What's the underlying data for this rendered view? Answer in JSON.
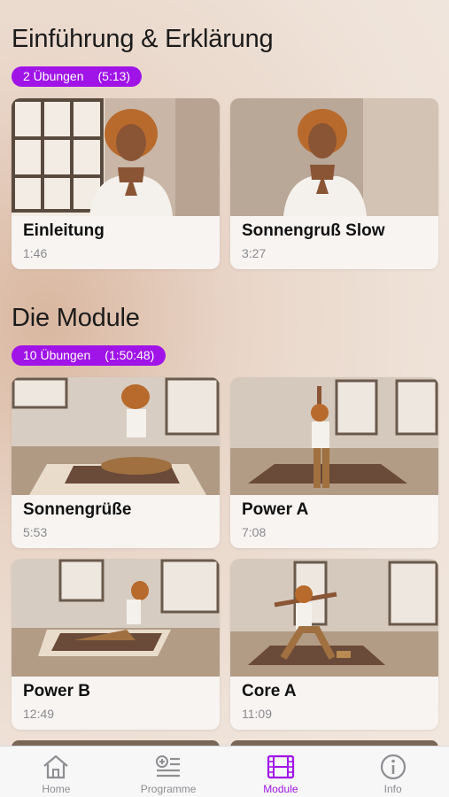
{
  "sections": [
    {
      "title": "Einführung & Erklärung",
      "pill": {
        "count": "2 Übungen",
        "duration": "(5:13)"
      },
      "cards": [
        {
          "title": "Einleitung",
          "duration": "1:46"
        },
        {
          "title": "Sonnengruß Slow",
          "duration": "3:27"
        }
      ]
    },
    {
      "title": "Die Module",
      "pill": {
        "count": "10 Übungen",
        "duration": "(1:50:48)"
      },
      "cards": [
        {
          "title": "Sonnengrüße",
          "duration": "5:53"
        },
        {
          "title": "Power A",
          "duration": "7:08"
        },
        {
          "title": "Power B",
          "duration": "12:49"
        },
        {
          "title": "Core A",
          "duration": "11:09"
        }
      ]
    }
  ],
  "tabbar": {
    "items": [
      {
        "label": "Home",
        "icon": "home-icon",
        "active": false
      },
      {
        "label": "Programme",
        "icon": "playlist-add-icon",
        "active": false
      },
      {
        "label": "Module",
        "icon": "film-icon",
        "active": true
      },
      {
        "label": "Info",
        "icon": "info-icon",
        "active": false
      }
    ]
  },
  "colors": {
    "accent": "#a014e8",
    "inactive": "#8e8e93"
  }
}
